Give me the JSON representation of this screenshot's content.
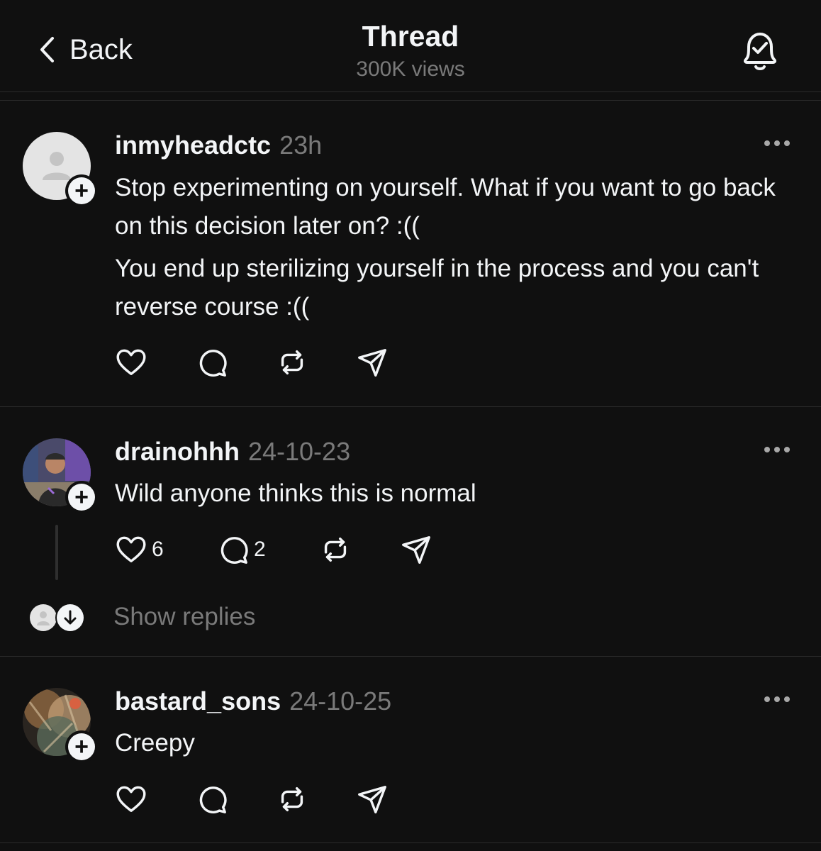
{
  "header": {
    "back_label": "Back",
    "title": "Thread",
    "views": "300K views",
    "bell_icon": "bell-check-icon"
  },
  "posts": [
    {
      "username": "inmyheadctc",
      "time": "23h",
      "avatar": "default-avatar",
      "paragraphs": [
        "Stop experimenting on yourself. What if you want to go back on this decision later on? :((",
        "You end up sterilizing yourself in the process and you can't reverse course :(("
      ],
      "likes": "",
      "replies": ""
    },
    {
      "username": "drainohhh",
      "time": "24-10-23",
      "avatar": "photo-avatar",
      "paragraphs": [
        "Wild anyone thinks this is normal"
      ],
      "likes": "6",
      "replies": "2",
      "show_replies": "Show replies"
    },
    {
      "username": "bastard_sons",
      "time": "24-10-25",
      "avatar": "photo-avatar",
      "paragraphs": [
        "Creepy"
      ],
      "likes": "",
      "replies": ""
    }
  ],
  "icons": [
    "chevron-left-icon",
    "bell-check-icon",
    "more-icon",
    "heart-icon",
    "comment-icon",
    "repost-icon",
    "share-icon",
    "plus-icon",
    "arrow-down-icon"
  ],
  "colors": {
    "background": "#101010",
    "text": "#f3f5f7",
    "muted": "#7a7a7a",
    "divider": "#2b2b2b"
  }
}
